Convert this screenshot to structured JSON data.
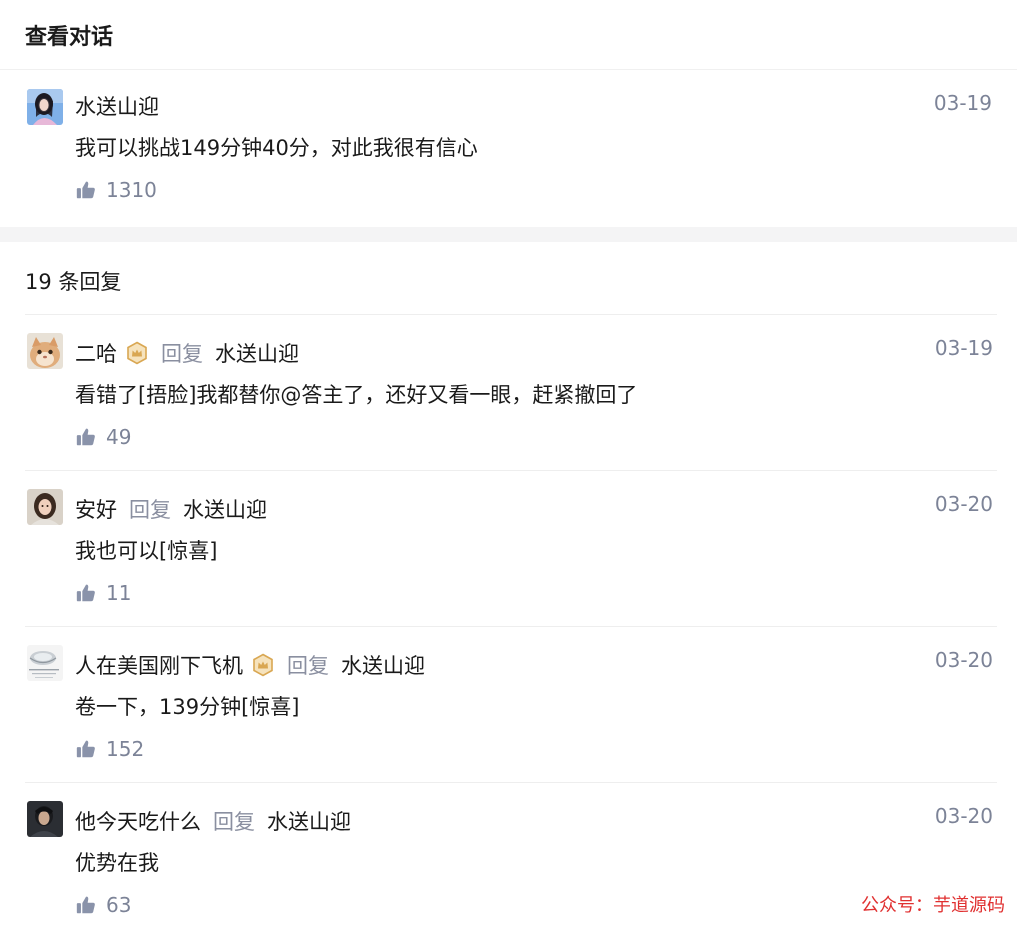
{
  "header": {
    "title": "查看对话"
  },
  "root": {
    "author": "水送山迎",
    "date": "03-19",
    "text": "我可以挑战149分钟40分，对此我很有信心",
    "likes": "1310"
  },
  "replies_header": {
    "count_text": "19 条回复"
  },
  "reply_word": "回复",
  "replies": [
    {
      "author": "二哈",
      "badge": true,
      "target": "水送山迎",
      "date": "03-19",
      "text": "看错了[捂脸]我都替你@答主了，还好又看一眼，赶紧撤回了",
      "likes": "49"
    },
    {
      "author": "安好",
      "badge": false,
      "target": "水送山迎",
      "date": "03-20",
      "text": "我也可以[惊喜]",
      "likes": "11"
    },
    {
      "author": "人在美国刚下飞机",
      "badge": true,
      "target": "水送山迎",
      "date": "03-20",
      "text": "卷一下，139分钟[惊喜]",
      "likes": "152"
    },
    {
      "author": "他今天吃什么",
      "badge": false,
      "target": "水送山迎",
      "date": "03-20",
      "text": "优势在我",
      "likes": "63"
    }
  ],
  "watermark": "公众号：芋道源码",
  "colors": {
    "muted": "#7c8397",
    "reply_word": "#8a8fa0",
    "badge": "#d9a752",
    "watermark": "#e03030"
  }
}
